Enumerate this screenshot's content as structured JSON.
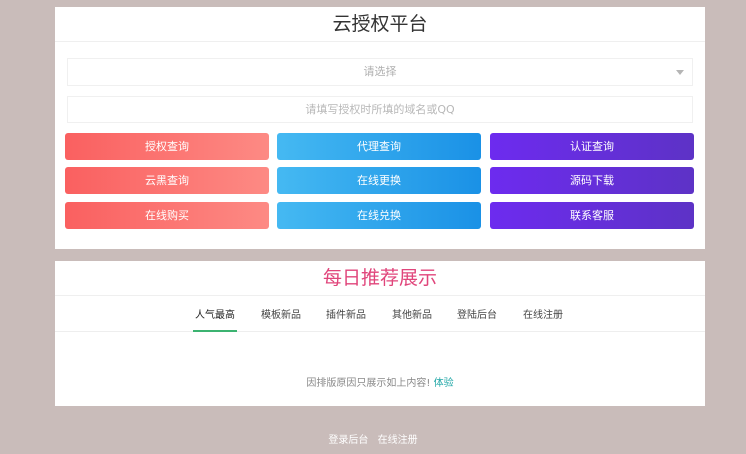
{
  "auth_card": {
    "title": "云授权平台",
    "select_placeholder": "请选择",
    "input_placeholder": "请填写授权时所填的域名或QQ",
    "buttons": [
      {
        "label": "授权查询"
      },
      {
        "label": "代理查询"
      },
      {
        "label": "认证查询"
      },
      {
        "label": "云黑查询"
      },
      {
        "label": "在线更换"
      },
      {
        "label": "源码下载"
      },
      {
        "label": "在线购买"
      },
      {
        "label": "在线兑换"
      },
      {
        "label": "联系客服"
      }
    ]
  },
  "recommend_card": {
    "title": "每日推荐展示",
    "tabs": [
      {
        "label": "人气最高"
      },
      {
        "label": "模板新品"
      },
      {
        "label": "插件新品"
      },
      {
        "label": "其他新品"
      },
      {
        "label": "登陆后台"
      },
      {
        "label": "在线注册"
      }
    ],
    "notice_text": "因排版原因只展示如上内容!",
    "notice_link": "体验"
  },
  "footer": {
    "login_link": "登录后台",
    "register_link": "在线注册"
  },
  "colors": {
    "background": "#c9bcba",
    "red_button": "#fa6060",
    "blue_button": "#1a91e6",
    "purple_button": "#6d2bef",
    "recommend_title": "#e0457b",
    "active_tab_underline": "#3cb371",
    "link": "#1fa6a6"
  },
  "icons": {
    "select_caret": "chevron-down-icon"
  }
}
